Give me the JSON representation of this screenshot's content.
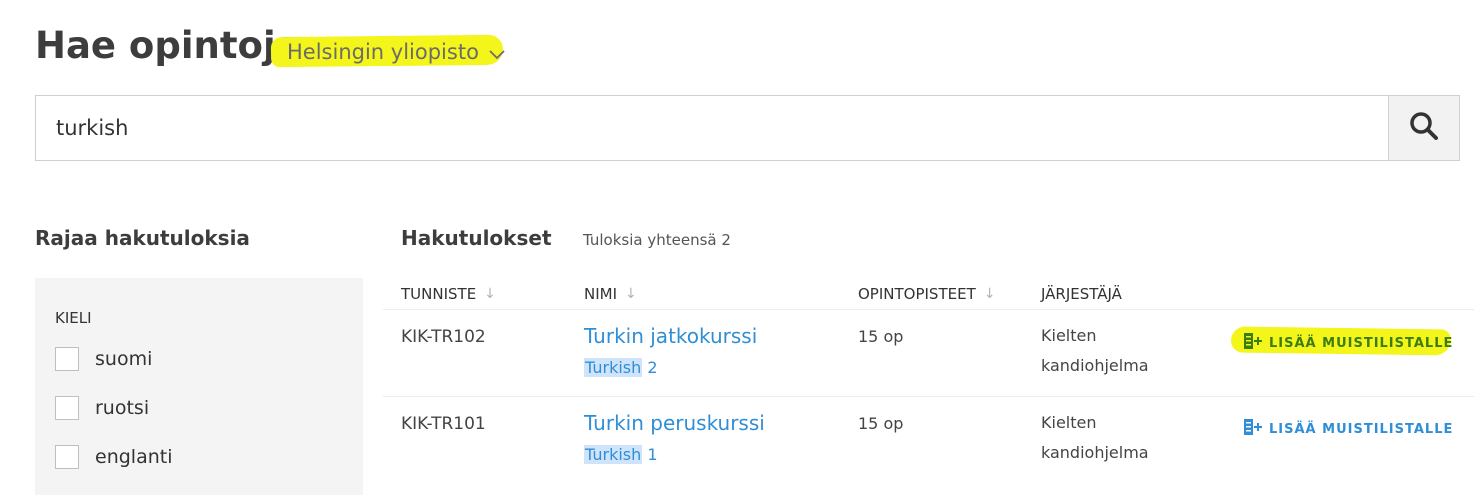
{
  "header": {
    "title": "Hae opintoja",
    "university": "Helsingin yliopisto",
    "university_chevron_icon": "chevron-down-icon",
    "highlight_color": "#f4f51a"
  },
  "search": {
    "value": "turkish",
    "button_icon": "search-icon"
  },
  "filters": {
    "title": "Rajaa hakutuloksia",
    "group_label": "KIELI",
    "options": [
      {
        "label": "suomi",
        "checked": false
      },
      {
        "label": "ruotsi",
        "checked": false
      },
      {
        "label": "englanti",
        "checked": false
      }
    ]
  },
  "results": {
    "title": "Hakutulokset",
    "count_text": "Tuloksia yhteensä 2",
    "columns": {
      "code": "TUNNISTE",
      "name": "NIMI",
      "credits": "OPINTOPISTEET",
      "organizer": "JÄRJESTÄJÄ"
    },
    "rows": [
      {
        "code": "KIK-TR102",
        "name": "Turkin jatkokurssi",
        "tag_match": "Turkish",
        "tag_rest": " 2",
        "credits": "15 op",
        "organizer_line1": "Kielten",
        "organizer_line2": "kandiohjelma",
        "add_label": "LISÄÄ MUISTILISTALLE"
      },
      {
        "code": "KIK-TR101",
        "name": "Turkin peruskurssi",
        "tag_match": "Turkish",
        "tag_rest": " 1",
        "credits": "15 op",
        "organizer_line1": "Kielten",
        "organizer_line2": "kandiohjelma",
        "add_label": "LISÄÄ MUISTILISTALLE"
      }
    ],
    "link_color": "#2f8ed6"
  }
}
